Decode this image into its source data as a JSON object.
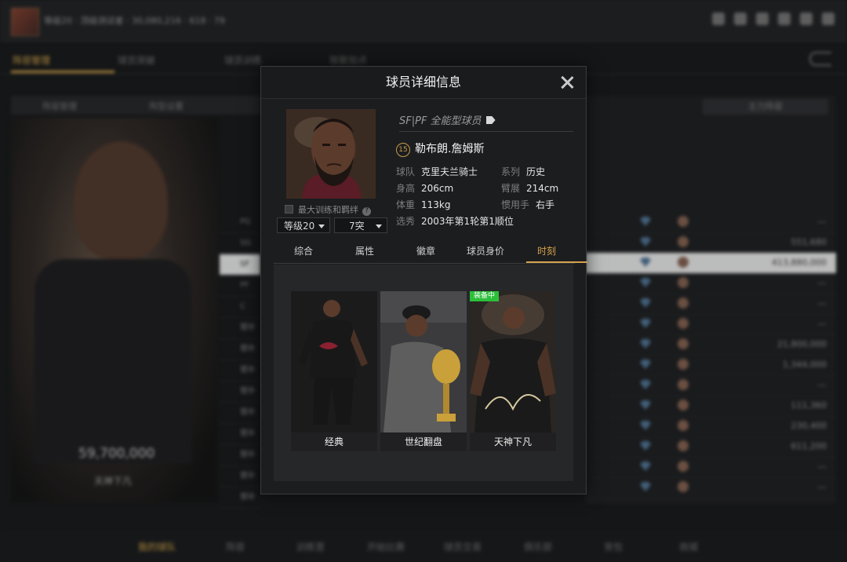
{
  "background": {
    "topbar": {
      "info": "等级20 · 顶级测试者 · 30,080,216 · 618 · 79"
    },
    "tabs": [
      "阵容管理",
      "球员突破",
      "球员训练",
      "技能加点"
    ],
    "subtabs": [
      "阵容管理",
      "阵型设置"
    ],
    "card": {
      "value": "59,700,000",
      "label": "天神下凡"
    },
    "rows": [
      {
        "pos": "PG",
        "val": "---"
      },
      {
        "pos": "SG",
        "val": "551,680"
      },
      {
        "pos": "SF",
        "val": "413,880,000",
        "selected": true
      },
      {
        "pos": "PF",
        "val": "---"
      },
      {
        "pos": "C",
        "val": "---"
      },
      {
        "pos": "替补",
        "val": "---"
      },
      {
        "pos": "替补",
        "val": "21,800,000"
      },
      {
        "pos": "替补",
        "val": "1,344,000"
      },
      {
        "pos": "替补",
        "val": "---"
      },
      {
        "pos": "替补",
        "val": "111,360"
      },
      {
        "pos": "替补",
        "val": "230,400"
      },
      {
        "pos": "替补",
        "val": "611,200"
      },
      {
        "pos": "替补",
        "val": "---"
      },
      {
        "pos": "替补",
        "val": "---"
      }
    ],
    "right_header": "主力阵容",
    "bottom": [
      "我的球队",
      "阵容",
      "训练营",
      "开始比赛",
      "球员交易",
      "俱乐部",
      "背包",
      "商城"
    ]
  },
  "modal": {
    "title": "球员详细信息",
    "position_line": "SF|PF 全能型球员",
    "jersey_number": "15",
    "player_name": "勒布朗.詹姆斯",
    "attributes": [
      {
        "key": "球队",
        "value": "克里夫兰骑士"
      },
      {
        "key": "系列",
        "value": "历史"
      },
      {
        "key": "身高",
        "value": "206cm"
      },
      {
        "key": "臂展",
        "value": "214cm"
      },
      {
        "key": "体重",
        "value": "113kg"
      },
      {
        "key": "惯用手",
        "value": "右手"
      },
      {
        "key": "选秀",
        "value": "2003年第1轮第1顺位"
      }
    ],
    "train_toggle": "最大训练和羁绊",
    "level_select": "等级20",
    "break_select": "7突",
    "tabs": [
      "综合",
      "属性",
      "徽章",
      "球员身价",
      "时刻"
    ],
    "active_tab": "时刻",
    "moments": [
      {
        "label": "经典"
      },
      {
        "label": "世纪翻盘"
      },
      {
        "label": "天神下凡",
        "badge": "装备中"
      }
    ]
  },
  "icons": {
    "close": "close-icon",
    "tag": "tag-icon",
    "help": "help-icon",
    "dropdown": "chevron-down-icon"
  },
  "colors": {
    "accent": "#d5a24b",
    "equipped": "#2cbf3a"
  }
}
